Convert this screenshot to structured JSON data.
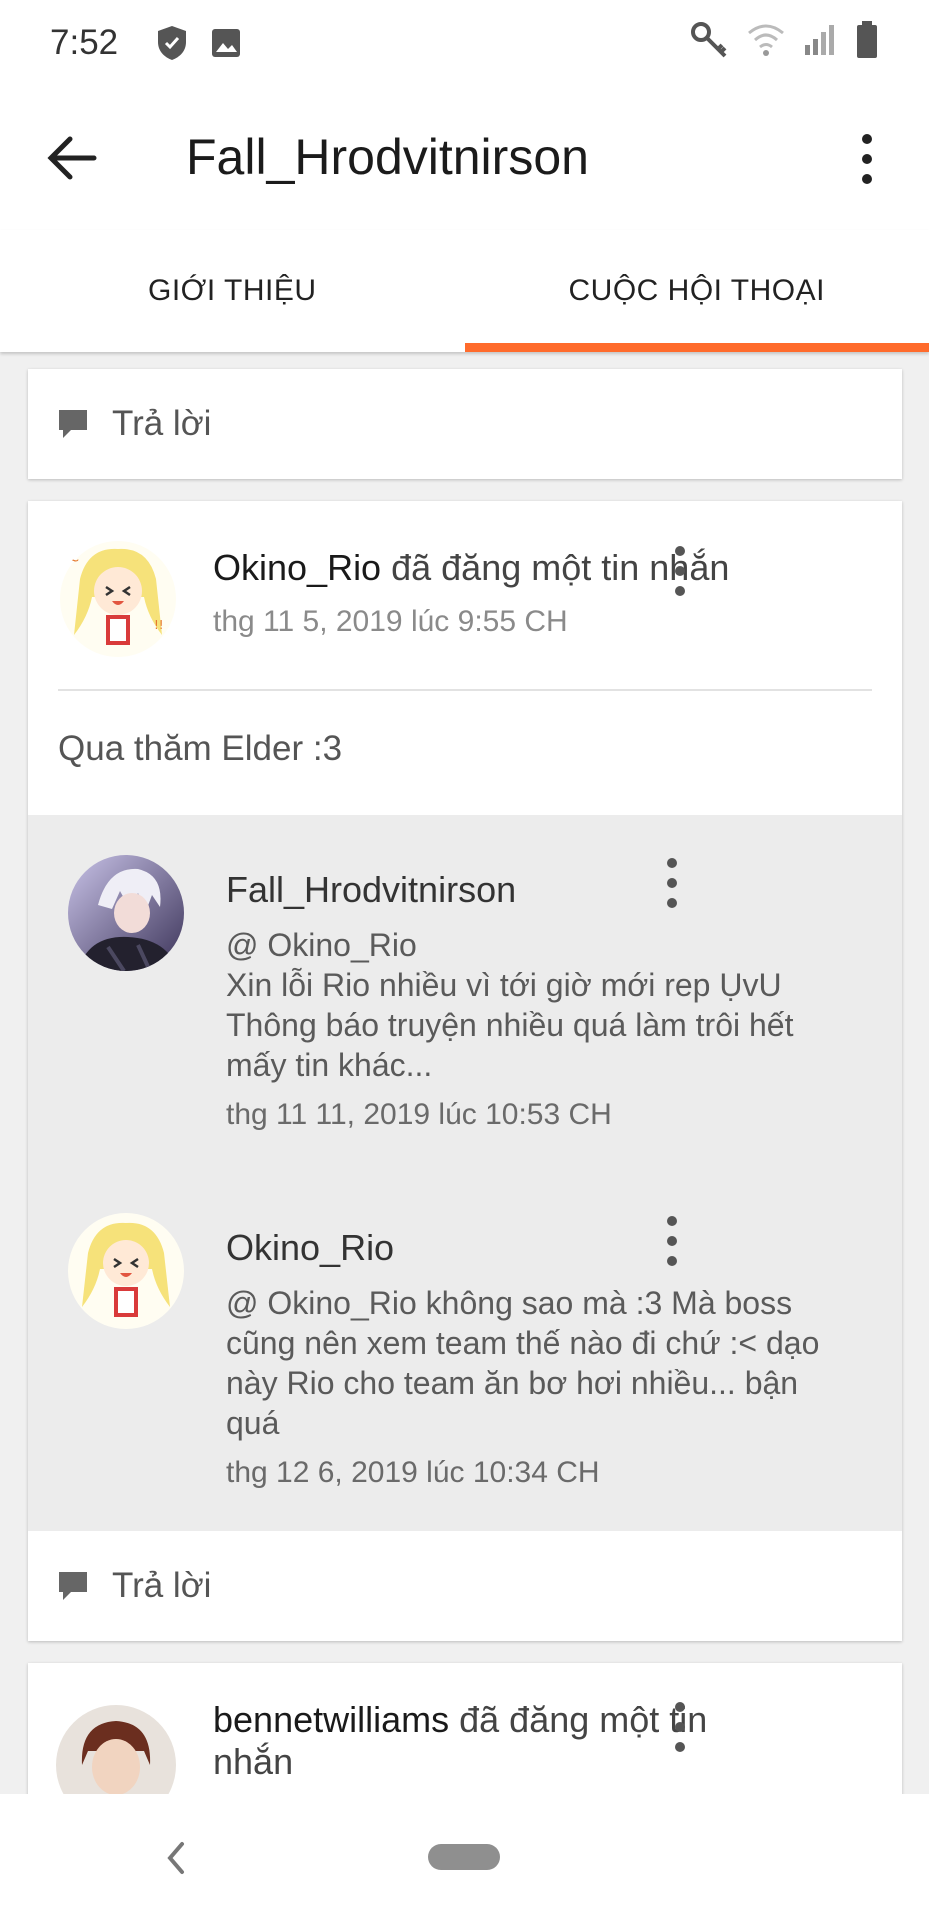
{
  "status_bar": {
    "time": "7:52",
    "icons": [
      "shield-icon",
      "image-icon",
      "key-icon",
      "wifi-icon",
      "signal-icon",
      "battery-icon"
    ]
  },
  "app_bar": {
    "title": "Fall_Hrodvitnirson"
  },
  "tabs": [
    {
      "label": "GIỚI THIỆU",
      "active": false
    },
    {
      "label": "CUỘC HỘI THOẠI",
      "active": true
    }
  ],
  "accent_color": "#ff6b2c",
  "reply_label": "Trả lời",
  "posts": [
    {
      "author": "Okino_Rio",
      "action": "đã đăng một tin nhắn",
      "date": "thg 11 5, 2019 lúc 9:55 CH",
      "body": "Qua thăm Elder :3",
      "comments": [
        {
          "author": "Fall_Hrodvitnirson",
          "mention": "@ Okino_Rio",
          "text": "Xin lỗi Rio nhiều vì tới giờ mới rep ỤvU Thông báo truyện nhiều quá làm trôi hết mấy tin khác...",
          "date": "thg 11 11, 2019 lúc 10:53 CH"
        },
        {
          "author": "Okino_Rio",
          "mention": "@ Okino_Rio",
          "text": " không sao mà :3 Mà boss cũng nên xem team thế nào đi chứ :< dạo này Rio cho team ăn bơ hơi nhiều... bận quá",
          "date": "thg 12 6, 2019 lúc 10:34 CH"
        }
      ]
    },
    {
      "author": "bennetwilliams",
      "action": "đã đăng một tin nhắn"
    }
  ]
}
